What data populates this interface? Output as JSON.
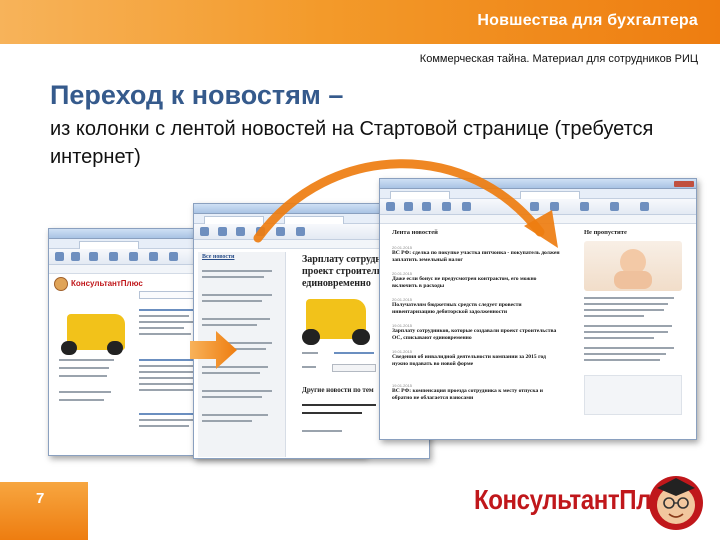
{
  "header": {
    "title": "Новшества для бухгалтера"
  },
  "confidential_note": "Коммерческая тайна. Материал для сотрудников РИЦ",
  "slide": {
    "heading": "Переход к новостям –",
    "subheading": "из колонки с лентой новостей на Стартовой странице (требуется интернет)"
  },
  "screens": {
    "start_page": {
      "logo": "КонсультантПлюс"
    },
    "news_window": {
      "feed_title": "Все новости",
      "article_title_lines": [
        "Зарплату сотрудник",
        "проект строительс",
        "единовременно"
      ],
      "other_news_title": "Другие новости по тем"
    },
    "news_feed": {
      "feed_title": "Лента новостей",
      "sidebar_title": "Не пропустите",
      "items": [
        {
          "date": "20.01.2015",
          "text": "ВС РФ: сделка по покупке участка питчонка - покупатель должен заплатить земельный налог"
        },
        {
          "date": "20.01.2015",
          "text": "Даже если бонус не предусмотрен контрактом, его можно включить в расходы"
        },
        {
          "date": "20.01.2015",
          "text": "Получателям бюджетных средств следует провести инвентаризацию дебиторской задолженности"
        },
        {
          "date": "19.01.2015",
          "text": "Зарплату сотрудников, которые создавали проект строительства ОС, списывают единовременно"
        },
        {
          "date": "19.01.2015",
          "text": "Сведения об инвалидной деятельности компании за 2015 год нужно подавать во новой форме"
        },
        {
          "date": "19.01.2015",
          "text": "ВС РФ: компенсация проезда сотрудника к месту отпуска и обратно не облагается взносами"
        }
      ]
    }
  },
  "footer": {
    "page_number": "7"
  },
  "brand": {
    "logo_text": "КонсультантПлюс"
  },
  "colors": {
    "accent_orange": "#ef8a1d",
    "heading_blue": "#355a8c",
    "brand_red": "#c0171b"
  }
}
